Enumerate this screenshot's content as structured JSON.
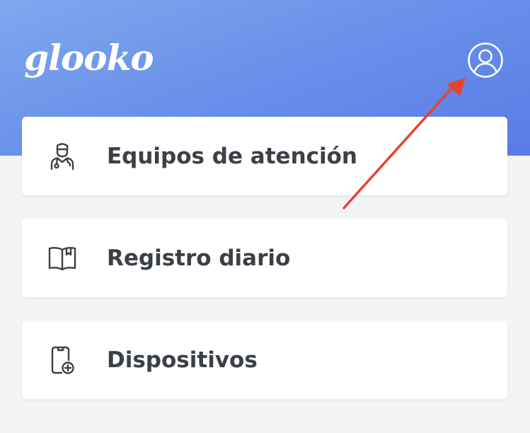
{
  "app": {
    "logo_text": "glooko"
  },
  "header": {
    "profile_icon": "user-circle-icon"
  },
  "menu": {
    "items": [
      {
        "label": "Equipos de atención",
        "icon": "doctor-icon"
      },
      {
        "label": "Registro diario",
        "icon": "book-icon"
      },
      {
        "label": "Dispositivos",
        "icon": "device-add-icon"
      }
    ]
  },
  "annotation": {
    "arrow_color": "#e8432e",
    "target": "profile-button"
  },
  "colors": {
    "header_start": "#7ea8ee",
    "header_end": "#5a7be6",
    "background": "#f3f4f6",
    "text": "#3b4048"
  }
}
